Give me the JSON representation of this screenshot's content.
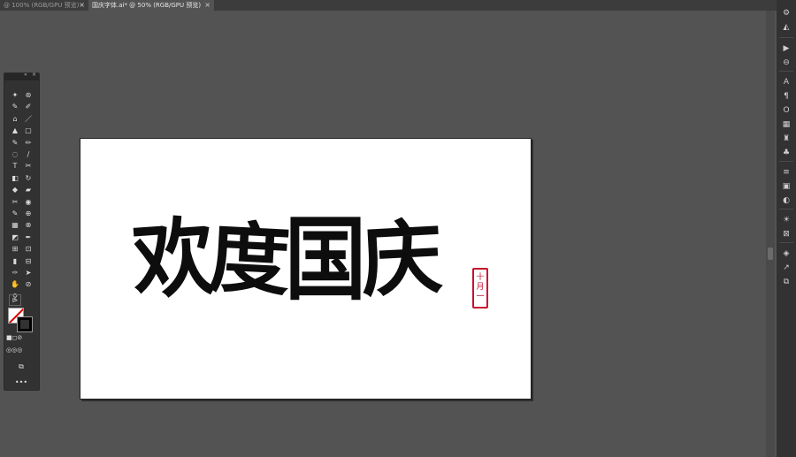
{
  "document_tabs": [
    {
      "label": "@ 100% (RGB/GPU 预览)",
      "active": false
    },
    {
      "label": "国庆字体.ai* @ 50% (RGB/GPU 预览)",
      "active": true
    }
  ],
  "close_glyph": "×",
  "toolbox": {
    "collapse_glyph": "«",
    "close_glyph": "×",
    "more_glyph": "•••",
    "tools": [
      [
        "✦",
        "⊛"
      ],
      [
        "✎",
        "✐"
      ],
      [
        "⌂",
        "／"
      ],
      [
        "▲",
        "▢"
      ],
      [
        "✎",
        "✏"
      ],
      [
        "◌",
        "∕"
      ],
      [
        "T",
        "✂"
      ],
      [
        "◧",
        "↻"
      ],
      [
        "◆",
        "▰"
      ],
      [
        "✂",
        "◉"
      ],
      [
        "✎",
        "⊕"
      ],
      [
        "▦",
        "⊗"
      ],
      [
        "◩",
        "✒"
      ],
      [
        "⊞",
        "⊡"
      ],
      [
        "▮",
        "⊟"
      ],
      [
        "✑",
        "➤"
      ],
      [
        "✋",
        "⊘"
      ],
      [
        "⚲",
        ""
      ]
    ]
  },
  "right_dock": {
    "icons": [
      "⚙",
      "◭",
      "▶",
      "⊖",
      "A",
      "¶",
      "O",
      "▦",
      "♜",
      "♣",
      "≡",
      "▣",
      "◐",
      "☀",
      "⊠",
      "◈",
      "↗",
      "⧉"
    ]
  },
  "artboard": {
    "calligraphy_text": [
      "欢",
      "度",
      "国",
      "庆"
    ],
    "seal_text": [
      "十",
      "月",
      "一",
      "日"
    ],
    "text_color": "#0d0d0d",
    "seal_color": "#c8102e"
  }
}
